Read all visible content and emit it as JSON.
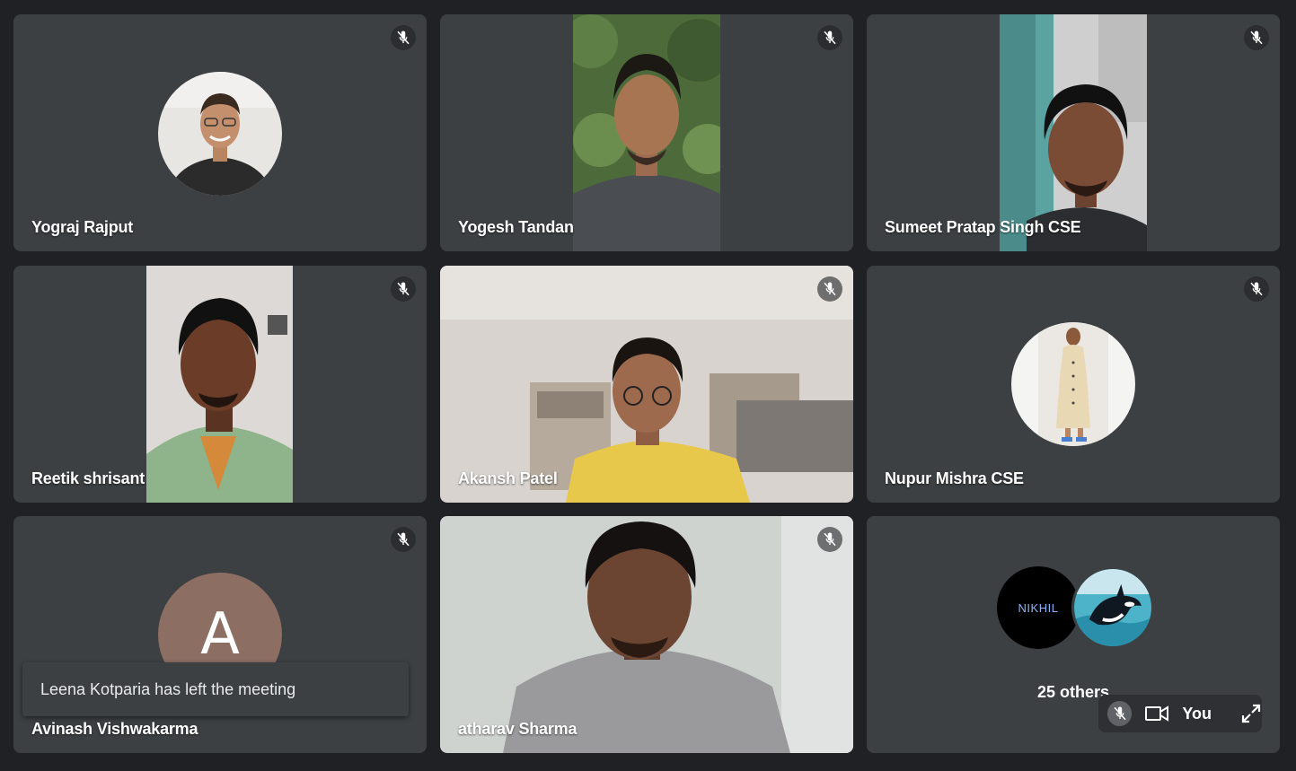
{
  "participants": [
    {
      "name": "Yograj Rajput",
      "muted": true
    },
    {
      "name": "Yogesh Tandan",
      "muted": true
    },
    {
      "name": "Sumeet Pratap Singh CSE",
      "muted": true
    },
    {
      "name": "Reetik shrisant",
      "muted": true
    },
    {
      "name": "Akansh Patel",
      "muted": true
    },
    {
      "name": "Nupur Mishra CSE",
      "muted": true
    },
    {
      "name": "Avinash Vishwakarma",
      "muted": true,
      "avatar_letter": "A",
      "avatar_color": "#8d6e63"
    },
    {
      "name": "atharav Sharma",
      "muted": true
    }
  ],
  "others": {
    "avatar1_text": "NIKHIL",
    "label": "25 others"
  },
  "self_view": {
    "label": "You",
    "mic_icon": "mic-off-icon",
    "camera_icon": "videocam-icon",
    "expand_icon": "expand-icon"
  },
  "toast": {
    "message": "Leena Kotparia has left the meeting"
  },
  "colors": {
    "background": "#202124",
    "tile": "#3c4043",
    "accent": "#8ab4f8"
  }
}
